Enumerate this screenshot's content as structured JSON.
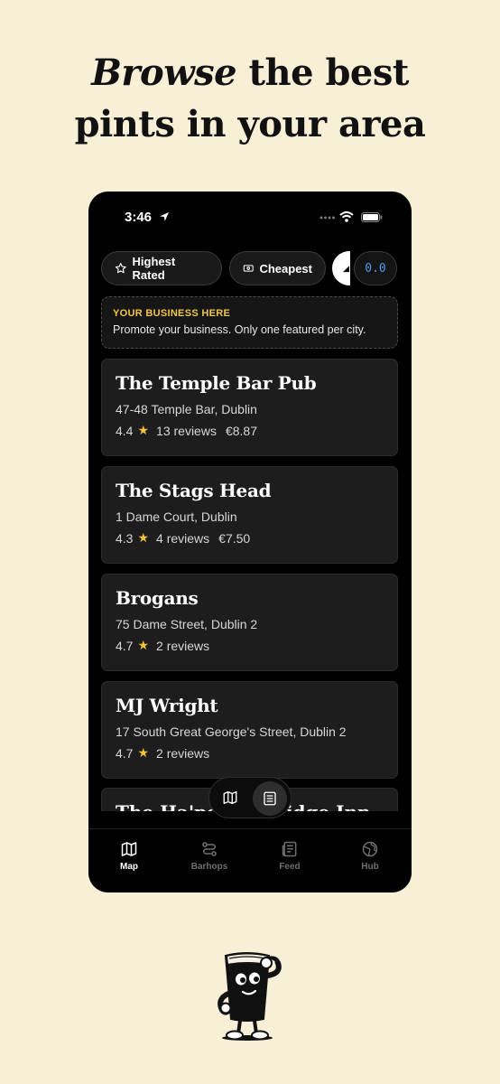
{
  "headline": {
    "italic": "Browse",
    "line1_rest": " the best",
    "line2": "pints in your area"
  },
  "status": {
    "time": "3:46"
  },
  "filters": {
    "highest_rated": "Highest Rated",
    "cheapest": "Cheapest",
    "rating_value": "0.0"
  },
  "promo": {
    "title": "YOUR BUSINESS HERE",
    "text": "Promote your business. Only one featured per city."
  },
  "pubs": [
    {
      "name": "The Temple Bar Pub",
      "address": "47-48 Temple Bar, Dublin",
      "rating": "4.4",
      "reviews": "13 reviews",
      "price": "€8.87"
    },
    {
      "name": "The Stags Head",
      "address": "1 Dame Court, Dublin",
      "rating": "4.3",
      "reviews": "4 reviews",
      "price": "€7.50"
    },
    {
      "name": "Brogans",
      "address": "75 Dame Street, Dublin 2",
      "rating": "4.7",
      "reviews": "2 reviews",
      "price": ""
    },
    {
      "name": "MJ Wright",
      "address": "17 South Great George's Street, Dublin 2",
      "rating": "4.7",
      "reviews": "2 reviews",
      "price": ""
    },
    {
      "name": "The Ha'penny Bridge Inn"
    }
  ],
  "tabs": [
    {
      "label": "Map",
      "icon": "map-icon"
    },
    {
      "label": "Barhops",
      "icon": "route-icon"
    },
    {
      "label": "Feed",
      "icon": "newspaper-icon"
    },
    {
      "label": "Hub",
      "icon": "globe-icon"
    }
  ],
  "colors": {
    "background": "#f8efd7",
    "accent_yellow": "#f1c74a",
    "star": "#f2c23b",
    "rating_blue": "#4a9cf0"
  }
}
